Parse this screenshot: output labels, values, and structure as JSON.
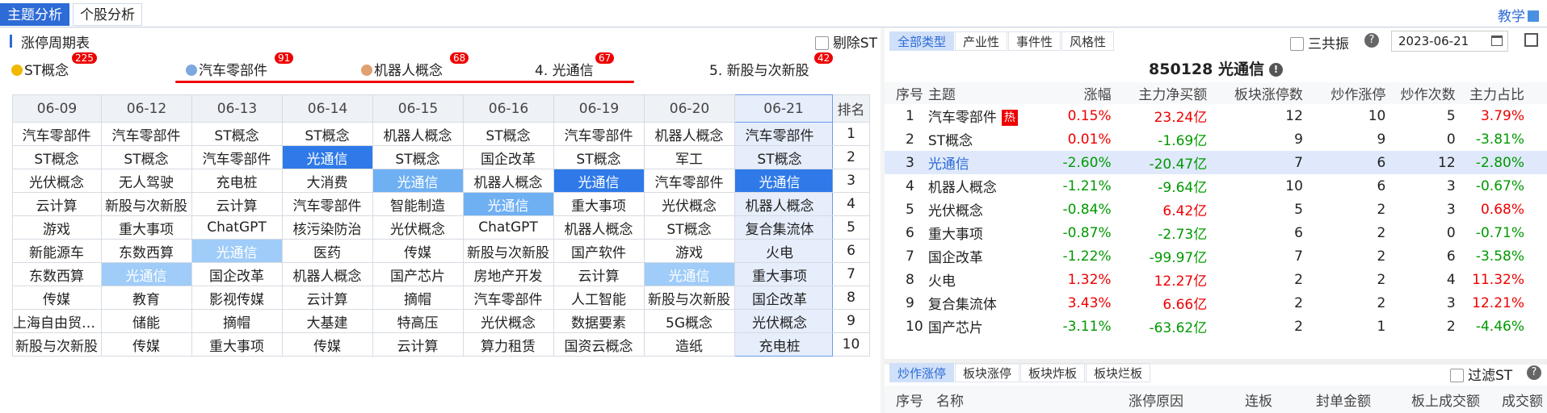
{
  "top_tabs": [
    "主题分析",
    "个股分析"
  ],
  "teach_label": "教学",
  "left": {
    "title": "涨停周期表",
    "st_filter": "剔除ST",
    "themes": [
      {
        "rank_label": "ST概念",
        "count": "225",
        "medal_color": "#f0b800"
      },
      {
        "rank_label": "汽车零部件",
        "count": "91",
        "medal_color": "#7ea8e0"
      },
      {
        "rank_label": "机器人概念",
        "count": "68",
        "medal_color": "#e0a070"
      },
      {
        "rank_label": "4. 光通信",
        "count": "67"
      },
      {
        "rank_label": "5. 新股与次新股",
        "count": "42"
      }
    ],
    "table": {
      "dates": [
        "06-09",
        "06-12",
        "06-13",
        "06-14",
        "06-15",
        "06-16",
        "06-19",
        "06-20",
        "06-21"
      ],
      "rank_header": "排名",
      "rows": [
        [
          "汽车零部件",
          "汽车零部件",
          "ST概念",
          "ST概念",
          "机器人概念",
          "ST概念",
          "汽车零部件",
          "机器人概念",
          "汽车零部件",
          "1"
        ],
        [
          "ST概念",
          "ST概念",
          "汽车零部件",
          "光通信",
          "ST概念",
          "国企改革",
          "ST概念",
          "军工",
          "ST概念",
          "2"
        ],
        [
          "光伏概念",
          "无人驾驶",
          "充电桩",
          "大消费",
          "光通信",
          "机器人概念",
          "光通信",
          "汽车零部件",
          "光通信",
          "3"
        ],
        [
          "云计算",
          "新股与次新股",
          "云计算",
          "汽车零部件",
          "智能制造",
          "光通信",
          "重大事项",
          "光伏概念",
          "机器人概念",
          "4"
        ],
        [
          "游戏",
          "重大事项",
          "ChatGPT",
          "核污染防治",
          "光伏概念",
          "ChatGPT",
          "机器人概念",
          "ST概念",
          "复合集流体",
          "5"
        ],
        [
          "新能源车",
          "东数西算",
          "光通信",
          "医药",
          "传媒",
          "新股与次新股",
          "国产软件",
          "游戏",
          "火电",
          "6"
        ],
        [
          "东数西算",
          "光通信",
          "国企改革",
          "机器人概念",
          "国产芯片",
          "房地产开发",
          "云计算",
          "光通信",
          "重大事项",
          "7"
        ],
        [
          "传媒",
          "教育",
          "影视传媒",
          "云计算",
          "摘帽",
          "汽车零部件",
          "人工智能",
          "新股与次新股",
          "国企改革",
          "8"
        ],
        [
          "上海自由贸易区",
          "储能",
          "摘帽",
          "大基建",
          "特高压",
          "光伏概念",
          "数据要素",
          "5G概念",
          "光伏概念",
          "9"
        ],
        [
          "新股与次新股",
          "传媒",
          "重大事项",
          "传媒",
          "云计算",
          "算力租赁",
          "国资云概念",
          "造纸",
          "充电桩",
          "10"
        ]
      ]
    }
  },
  "right": {
    "tabs": [
      "全部类型",
      "产业性",
      "事件性",
      "风格性"
    ],
    "sangong": "三共振",
    "date": "2023-06-21",
    "title": "850128 光通信",
    "headers": [
      "序号",
      "主题",
      "涨幅",
      "主力净买额",
      "板块涨停数",
      "炒作涨停",
      "炒作次数",
      "主力占比"
    ],
    "hot_label": "热",
    "rows": [
      [
        "1",
        "汽车零部件",
        "0.15%",
        "23.24亿",
        "12",
        "10",
        "5",
        "3.79%"
      ],
      [
        "2",
        "ST概念",
        "0.01%",
        "-1.69亿",
        "9",
        "9",
        "0",
        "-3.81%"
      ],
      [
        "3",
        "光通信",
        "-2.60%",
        "-20.47亿",
        "7",
        "6",
        "12",
        "-2.80%"
      ],
      [
        "4",
        "机器人概念",
        "-1.21%",
        "-9.64亿",
        "10",
        "6",
        "3",
        "-0.67%"
      ],
      [
        "5",
        "光伏概念",
        "-0.84%",
        "6.42亿",
        "5",
        "2",
        "3",
        "0.68%"
      ],
      [
        "6",
        "重大事项",
        "-0.87%",
        "-2.73亿",
        "6",
        "2",
        "0",
        "-0.71%"
      ],
      [
        "7",
        "国企改革",
        "-1.22%",
        "-99.97亿",
        "7",
        "2",
        "6",
        "-3.58%"
      ],
      [
        "8",
        "火电",
        "1.32%",
        "12.27亿",
        "2",
        "2",
        "4",
        "11.32%"
      ],
      [
        "9",
        "复合集流体",
        "3.43%",
        "6.66亿",
        "2",
        "2",
        "3",
        "12.21%"
      ],
      [
        "10",
        "国产芯片",
        "-3.11%",
        "-63.62亿",
        "2",
        "1",
        "2",
        "-4.46%"
      ]
    ],
    "bottom_tabs": [
      "炒作涨停",
      "板块涨停",
      "板块炸板",
      "板块烂板"
    ],
    "bottom_filter": "过滤ST",
    "bottom_headers": [
      "序号",
      "名称",
      "涨停原因",
      "连板",
      "封单金额",
      "板上成交额",
      "成交额"
    ]
  }
}
